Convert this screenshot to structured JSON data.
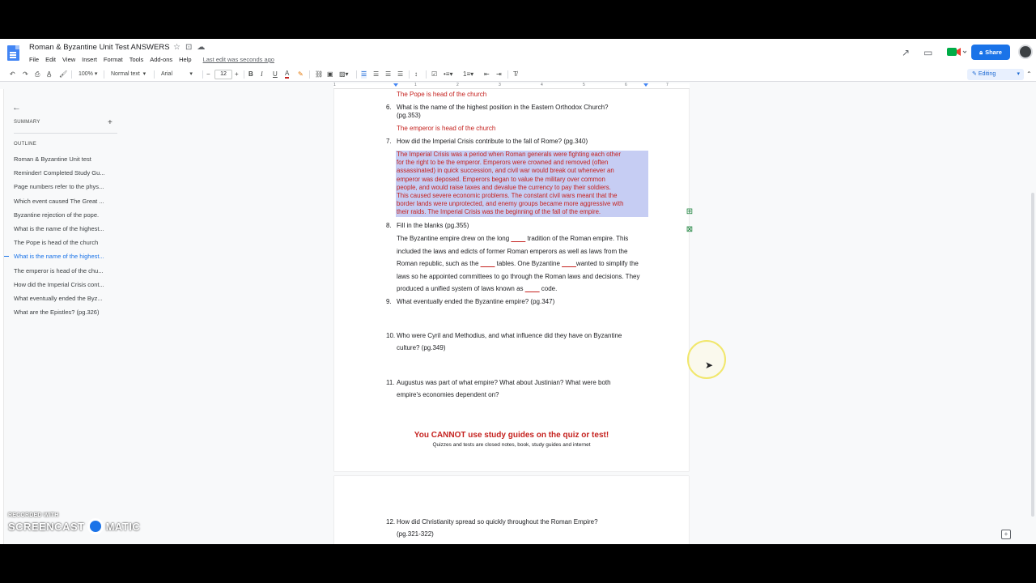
{
  "doc": {
    "title": "Roman & Byzantine Unit Test ANSWERS",
    "menu": [
      "File",
      "Edit",
      "View",
      "Insert",
      "Format",
      "Tools",
      "Add-ons",
      "Help"
    ],
    "last_edit": "Last edit was seconds ago",
    "share_label": "Share"
  },
  "toolbar": {
    "zoom": "100%",
    "style": "Normal text",
    "font": "Arial",
    "font_size": "12",
    "mode": "Editing"
  },
  "ruler": [
    "1",
    "1",
    "2",
    "3",
    "4",
    "5",
    "6",
    "7"
  ],
  "sidebar": {
    "summary_label": "SUMMARY",
    "outline_label": "OUTLINE",
    "items": [
      "Roman & Byzantine Unit test",
      "Reminder! Completed Study Gu...",
      "Page numbers refer to the phys...",
      "Which event caused The Great ...",
      "Byzantine rejection of the pope.",
      "What is the name of the highest...",
      "The Pope is head of the church",
      "What is the name of the highest...",
      "The emperor is head of the chu...",
      "How did the Imperial Crisis cont...",
      "What eventually ended the Byz...",
      "What are the Epistles? (pg.326)"
    ],
    "active_index": 7
  },
  "page1": {
    "ans_pope": "The Pope is head of the church",
    "q6_num": "6.",
    "q6_line1": "What is the name of the highest position in the Eastern Orthodox Church?",
    "q6_line2": "(pg.353)",
    "ans_emperor": "The emperor is head of the church",
    "q7_num": "7.",
    "q7": "How did the Imperial Crisis contribute to the fall of Rome? (pg.340)",
    "q7_answer": [
      "The Imperial Crisis was a period when Roman generals were fighting each other",
      "for the right to be the emperor. Emperors were crowned and removed (often",
      "assassinated) in quick succession, and civil war would break out whenever an",
      "emperor was deposed. Emperors began to value the military over common",
      "people, and would raise taxes and devalue the currency to pay their soldiers.",
      "This caused severe economic problems. The constant civil wars meant that the",
      "border lands were unprotected, and enemy groups became more aggressive with",
      "their raids. The Imperial Crisis was the beginning of the fall of the empire."
    ],
    "q8_num": "8.",
    "q8": "Fill in the blanks (pg.355)",
    "q8_fill": {
      "p1": "The Byzantine empire drew on the long ",
      "b1": "____",
      "p2": " tradition of the Roman empire. This included the laws and edicts of former Roman emperors as well as laws from the Roman republic, such as the ",
      "b2": "____",
      "p3": " tables. One Byzantine ",
      "b3": "____",
      "p4": "wanted to simplify the laws so he appointed committees to go through the Roman laws and decisions. They produced a unified system of laws known as ",
      "b4": "____",
      "p5": " code."
    },
    "q9_num": "9.",
    "q9": "What eventually ended the Byzantine empire? (pg.347)",
    "q10_num": "10.",
    "q10_line1": "Who were Cyril and Methodius, and what influence did they have on Byzantine",
    "q10_line2": "culture? (pg.349)",
    "q11_num": "11.",
    "q11_line1": "Augustus was part of what empire? What about Justinian? What were both",
    "q11_line2": "empire's economies dependent on?",
    "warning_title": "You CANNOT use study guides on the quiz or test!",
    "warning_sub": "Quizzes and tests are closed notes, book, study guides and internet"
  },
  "page2": {
    "q12_num": "12.",
    "q12_line1": "How did Christianity spread so quickly throughout the Roman Empire?",
    "q12_line2": "(pg.321-322)"
  },
  "watermark": {
    "small": "RECORDED WITH",
    "left": "SCREENCAST",
    "right": "MATIC"
  },
  "colors": {
    "accent": "#1a73e8",
    "answer_red": "#c5221f",
    "highlight": "#c6cdf3"
  }
}
